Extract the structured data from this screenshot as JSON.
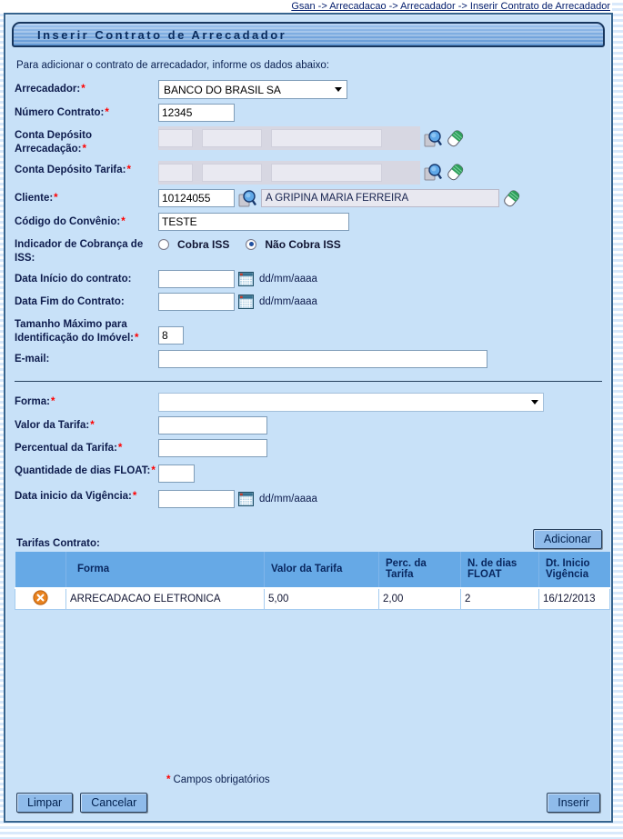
{
  "required_marker": "*",
  "breadcrumb": "Gsan -> Arrecadacao -> Arrecadador -> Inserir Contrato de Arrecadador",
  "title": "Inserir Contrato de Arrecadador",
  "intro": "Para adicionar o contrato de arrecadador, informe os dados abaixo:",
  "fields": {
    "arrecadador": {
      "label": "Arrecadador:",
      "value": "BANCO DO BRASIL SA"
    },
    "numero_contrato": {
      "label": "Número Contrato:",
      "value": "12345"
    },
    "conta_deposito_arrecadacao": {
      "label": "Conta Depósito Arrecadação:"
    },
    "conta_deposito_tarifa": {
      "label": "Conta Depósito Tarifa:"
    },
    "cliente": {
      "label": "Cliente:",
      "code": "10124055",
      "name": "A GRIPINA MARIA FERREIRA"
    },
    "codigo_convenio": {
      "label": "Código do Convênio:",
      "value": "TESTE"
    },
    "indicador_iss": {
      "label": "Indicador de Cobrança de ISS:",
      "option_cobra": "Cobra ISS",
      "option_nao_cobra": "Não Cobra ISS",
      "selected": "Não Cobra ISS"
    },
    "data_inicio_contrato": {
      "label": "Data Início do contrato:",
      "value": "",
      "hint": "dd/mm/aaaa"
    },
    "data_fim_contrato": {
      "label": "Data Fim do Contrato:",
      "value": "",
      "hint": "dd/mm/aaaa"
    },
    "tamanho_maximo": {
      "label": "Tamanho Máximo para Identificação do Imóvel:",
      "value": "8"
    },
    "email": {
      "label": "E-mail:",
      "value": ""
    },
    "forma": {
      "label": "Forma:",
      "value": ""
    },
    "valor_tarifa": {
      "label": "Valor da Tarifa:",
      "value": ""
    },
    "percentual_tarifa": {
      "label": "Percentual da Tarifa:",
      "value": ""
    },
    "qtd_dias_float": {
      "label": "Quantidade de dias FLOAT:",
      "value": ""
    },
    "data_inicio_vigencia": {
      "label": "Data inicio da Vigência:",
      "value": "",
      "hint": "dd/mm/aaaa"
    }
  },
  "tarifas": {
    "label": "Tarifas Contrato:",
    "add_button": "Adicionar",
    "columns": [
      "Forma",
      "Valor da Tarifa",
      "Perc. da Tarifa",
      "N. de dias FLOAT",
      "Dt. Inicio Vigência"
    ],
    "rows": [
      {
        "forma": "ARRECADACAO ELETRONICA",
        "valor": "5,00",
        "perc": "2,00",
        "dias_float": "2",
        "inicio_vigencia": "16/12/2013"
      }
    ]
  },
  "footer": {
    "note": "Campos obrigatórios",
    "limpar": "Limpar",
    "cancelar": "Cancelar",
    "inserir": "Inserir"
  },
  "colors": {
    "panel_bg": "#C8E1F8",
    "table_header_bg": "#66A9E6",
    "button_bg": "#8FBBEA",
    "titlebar_border": "#17365E",
    "required_red": "#FF0000",
    "delete_orange": "#E8821E"
  }
}
